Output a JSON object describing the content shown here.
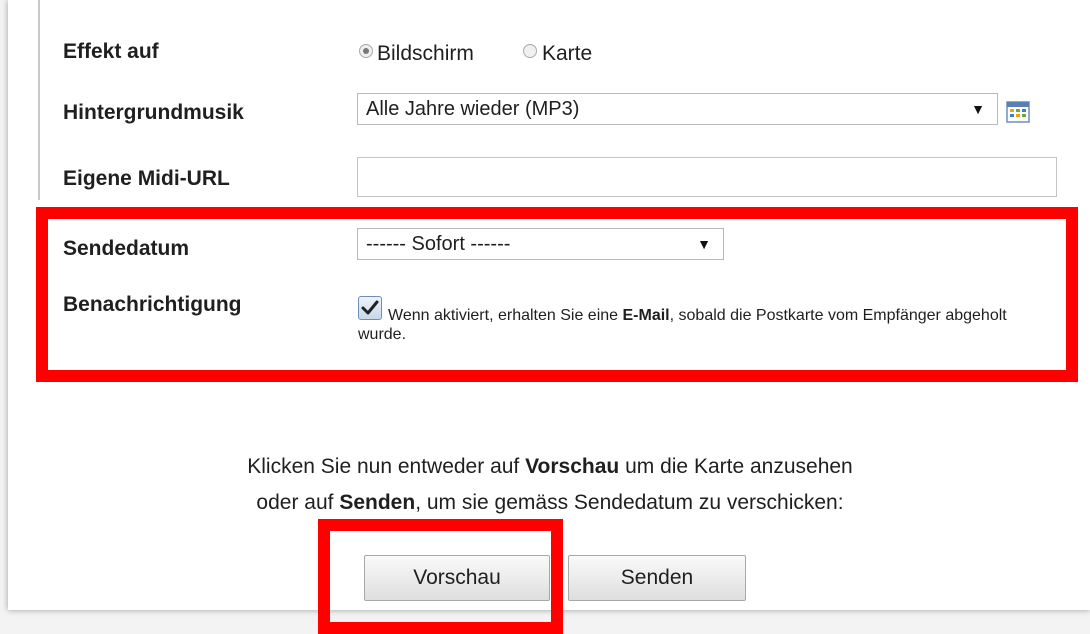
{
  "form": {
    "effect": {
      "label": "Effekt auf",
      "options": [
        {
          "label": "Bildschirm",
          "checked": true
        },
        {
          "label": "Karte",
          "checked": false
        }
      ]
    },
    "music": {
      "label": "Hintergrundmusik",
      "selected": "Alle Jahre wieder (MP3)",
      "arrow": "▼",
      "icon": "calendar-grid-icon"
    },
    "midi": {
      "label": "Eigene Midi-URL",
      "value": ""
    },
    "send_date": {
      "label": "Sendedatum",
      "selected": "------ Sofort ------",
      "arrow": "▼"
    },
    "notification": {
      "label": "Benachrichtigung",
      "checked": true,
      "text_part1": "Wenn aktiviert, erhalten Sie eine ",
      "text_bold": "E-Mail",
      "text_part2": ", sobald die Postkarte vom Empfänger abgeholt wurde."
    }
  },
  "instructions": {
    "line1_prefix": "Klicken Sie nun entweder auf ",
    "line1_bold": "Vorschau",
    "line1_suffix": " um die Karte anzusehen",
    "line2_prefix": "oder auf ",
    "line2_bold": "Senden",
    "line2_suffix": ", um sie gemäss Sendedatum zu verschicken:"
  },
  "buttons": {
    "preview": "Vorschau",
    "send": "Senden"
  },
  "colors": {
    "highlight": "#ff0000"
  }
}
